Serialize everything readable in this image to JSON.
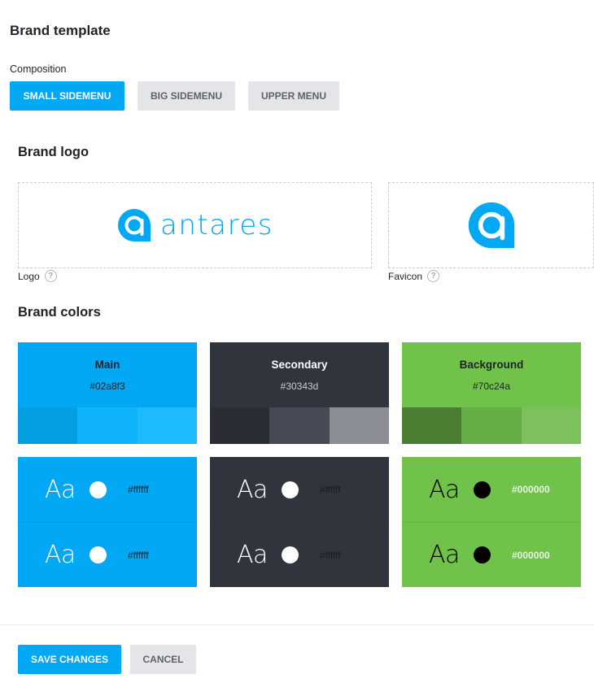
{
  "page": {
    "title": "Brand template"
  },
  "composition": {
    "label": "Composition",
    "options": [
      "SMALL SIDEMENU",
      "BIG SIDEMENU",
      "UPPER MENU"
    ],
    "selected": "SMALL SIDEMENU"
  },
  "brand_logo": {
    "title": "Brand logo",
    "logo_label": "Logo",
    "favicon_label": "Favicon",
    "help_glyph": "?",
    "logo_wordmark": "antares",
    "logo_icon": "antares-a-icon",
    "favicon_icon": "antares-a-icon"
  },
  "brand_colors": {
    "title": "Brand colors",
    "swatches": [
      {
        "name": "Main",
        "hex": "#02a8f3",
        "color": "#02a8f3",
        "name_color": "#1f2229",
        "hex_color": "#1f2229",
        "shades": [
          "#039fe0",
          "#0fb3fb",
          "#1fbbff"
        ]
      },
      {
        "name": "Secondary",
        "hex": "#30343d",
        "color": "#30343d",
        "name_color": "#ffffff",
        "hex_color": "#c9ccd2",
        "shades": [
          "#2a2d34",
          "#464a54",
          "#8a8d94"
        ]
      },
      {
        "name": "Background",
        "hex": "#70c24a",
        "color": "#70c24a",
        "name_color": "#1f2229",
        "hex_color": "#1f2229",
        "shades": [
          "#4a7f33",
          "#65ad45",
          "#7cc15d"
        ]
      }
    ],
    "text_samples": [
      {
        "bg": "#02a8f3",
        "text_color": "#ffffff",
        "hex_color": "#1f2229",
        "rows": [
          {
            "sample": "Aa",
            "hex": "#ffffff"
          },
          {
            "sample": "Aa",
            "hex": "#ffffff"
          }
        ]
      },
      {
        "bg": "#30343d",
        "text_color": "#ffffff",
        "hex_color": "#1a1c21",
        "rows": [
          {
            "sample": "Aa",
            "hex": "#ffffff"
          },
          {
            "sample": "Aa",
            "hex": "#ffffff"
          }
        ]
      },
      {
        "bg": "#70c24a",
        "text_color": "#000000",
        "hex_color": "#e9f5e2",
        "rows": [
          {
            "sample": "Aa",
            "hex": "#000000"
          },
          {
            "sample": "Aa",
            "hex": "#000000"
          }
        ]
      }
    ]
  },
  "actions": {
    "save_label": "SAVE CHANGES",
    "cancel_label": "CANCEL"
  },
  "colors": {
    "accent": "#02a8f3",
    "button_grey": "#e3e5e8"
  }
}
